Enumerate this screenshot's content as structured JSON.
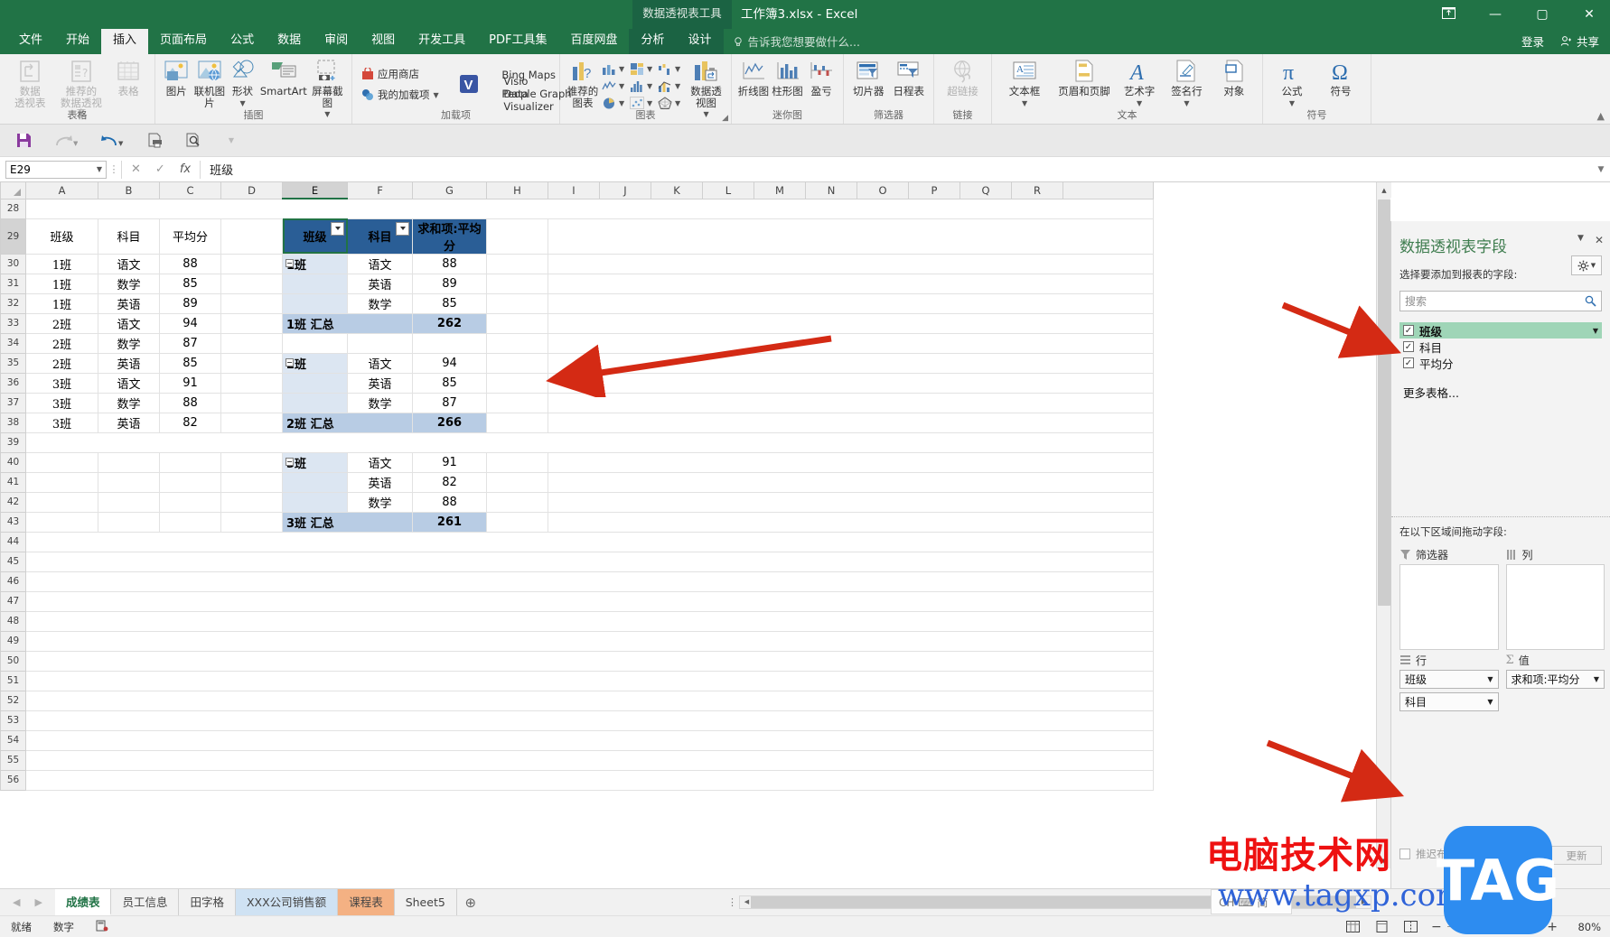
{
  "titlebar": {
    "context_tab_group": "数据透视表工具",
    "document_title": "工作簿3.xlsx - Excel",
    "signin": "登录",
    "share": "共享",
    "ribbon_display_icon": "ribbon-display-options-icon",
    "minimize": "—",
    "maximize": "▢",
    "close": "✕"
  },
  "tabs": [
    {
      "label": "文件",
      "active": false,
      "ctx": false
    },
    {
      "label": "开始",
      "active": false,
      "ctx": false
    },
    {
      "label": "插入",
      "active": true,
      "ctx": false
    },
    {
      "label": "页面布局",
      "active": false,
      "ctx": false
    },
    {
      "label": "公式",
      "active": false,
      "ctx": false
    },
    {
      "label": "数据",
      "active": false,
      "ctx": false
    },
    {
      "label": "审阅",
      "active": false,
      "ctx": false
    },
    {
      "label": "视图",
      "active": false,
      "ctx": false
    },
    {
      "label": "开发工具",
      "active": false,
      "ctx": false
    },
    {
      "label": "PDF工具集",
      "active": false,
      "ctx": false
    },
    {
      "label": "百度网盘",
      "active": false,
      "ctx": false
    },
    {
      "label": "分析",
      "active": false,
      "ctx": true
    },
    {
      "label": "设计",
      "active": false,
      "ctx": true
    }
  ],
  "tell_me": "告诉我您想要做什么...",
  "ribbon_groups": [
    {
      "name": "表格",
      "label": "表格",
      "items": [
        {
          "label": "数据\n透视表",
          "icon": "pivot-table-icon",
          "disabled": true,
          "caret": false
        },
        {
          "label": "推荐的\n数据透视表",
          "icon": "recommended-pivot-table-icon",
          "disabled": true,
          "caret": false
        },
        {
          "label": "表格",
          "icon": "table-icon",
          "disabled": true,
          "caret": false
        }
      ]
    },
    {
      "name": "插图",
      "label": "插图",
      "items": [
        {
          "label": "图片",
          "icon": "picture-icon",
          "disabled": false,
          "caret": false
        },
        {
          "label": "联机图片",
          "icon": "online-picture-icon",
          "disabled": false,
          "caret": false
        },
        {
          "label": "形状",
          "icon": "shapes-icon",
          "disabled": false,
          "caret": true
        },
        {
          "label": "SmartArt",
          "icon": "smartart-icon",
          "disabled": false,
          "caret": false
        },
        {
          "label": "屏幕截图",
          "icon": "screenshot-icon",
          "disabled": false,
          "caret": true
        }
      ]
    },
    {
      "name": "加载项",
      "label": "加载项",
      "items": [
        {
          "label": "应用商店",
          "icon": "store-icon",
          "disabled": false,
          "caret": false
        },
        {
          "label": "我的加载项",
          "icon": "my-addins-icon",
          "disabled": false,
          "caret": true
        },
        {
          "label": "Bing Maps",
          "icon": "bing-maps-icon",
          "disabled": false,
          "caret": false
        },
        {
          "label": "People Graph",
          "icon": "people-graph-icon",
          "disabled": false,
          "caret": false
        },
        {
          "label": "Visio Data Visualizer",
          "icon": "visio-data-visualizer-icon",
          "disabled": false,
          "caret": false
        }
      ]
    },
    {
      "name": "图表",
      "label": "图表",
      "items": [
        {
          "label": "推荐的\n图表",
          "icon": "recommended-charts-icon",
          "disabled": false,
          "caret": false
        },
        {
          "label": "",
          "icon": "column-chart-icon",
          "disabled": false,
          "caret": true
        },
        {
          "label": "",
          "icon": "hierarchy-chart-icon",
          "disabled": false,
          "caret": true
        },
        {
          "label": "",
          "icon": "waterfall-chart-icon",
          "disabled": false,
          "caret": true
        },
        {
          "label": "",
          "icon": "line-chart-icon",
          "disabled": false,
          "caret": true
        },
        {
          "label": "",
          "icon": "statistic-chart-icon",
          "disabled": false,
          "caret": true
        },
        {
          "label": "",
          "icon": "combo-chart-icon",
          "disabled": false,
          "caret": true
        },
        {
          "label": "",
          "icon": "pie-chart-icon",
          "disabled": false,
          "caret": true
        },
        {
          "label": "",
          "icon": "scatter-chart-icon",
          "disabled": false,
          "caret": true
        },
        {
          "label": "",
          "icon": "radar-chart-icon",
          "disabled": false,
          "caret": true
        },
        {
          "label": "数据透视图",
          "icon": "pivot-chart-icon",
          "disabled": false,
          "caret": true
        }
      ]
    },
    {
      "name": "迷你图",
      "label": "迷你图",
      "items": [
        {
          "label": "折线图",
          "icon": "sparkline-line-icon",
          "disabled": false,
          "caret": false
        },
        {
          "label": "柱形图",
          "icon": "sparkline-column-icon",
          "disabled": false,
          "caret": false
        },
        {
          "label": "盈亏",
          "icon": "sparkline-winloss-icon",
          "disabled": false,
          "caret": false
        }
      ]
    },
    {
      "name": "筛选器",
      "label": "筛选器",
      "items": [
        {
          "label": "切片器",
          "icon": "slicer-icon",
          "disabled": false,
          "caret": false
        },
        {
          "label": "日程表",
          "icon": "timeline-icon",
          "disabled": false,
          "caret": false
        }
      ]
    },
    {
      "name": "链接",
      "label": "链接",
      "items": [
        {
          "label": "超链接",
          "icon": "hyperlink-icon",
          "disabled": true,
          "caret": false
        }
      ]
    },
    {
      "name": "文本",
      "label": "文本",
      "items": [
        {
          "label": "文本框",
          "icon": "text-box-icon",
          "disabled": false,
          "caret": true
        },
        {
          "label": "页眉和页脚",
          "icon": "header-footer-icon",
          "disabled": false,
          "caret": false
        },
        {
          "label": "艺术字",
          "icon": "wordart-icon",
          "disabled": false,
          "caret": true
        },
        {
          "label": "签名行",
          "icon": "signature-line-icon",
          "disabled": false,
          "caret": true
        },
        {
          "label": "对象",
          "icon": "object-icon",
          "disabled": false,
          "caret": false
        }
      ]
    },
    {
      "name": "符号",
      "label": "符号",
      "items": [
        {
          "label": "公式",
          "icon": "equation-icon",
          "disabled": false,
          "caret": true
        },
        {
          "label": "符号",
          "icon": "symbol-icon",
          "disabled": false,
          "caret": false
        }
      ]
    }
  ],
  "qat": [
    "save-icon",
    "redo-icon",
    "undo-icon",
    "print-preview-icon",
    "quick-print-icon",
    "customize-qat-icon"
  ],
  "formula_bar": {
    "name_box_value": "E29",
    "cancel": "✕",
    "confirm": "✓",
    "fx": "fx",
    "formula_value": "班级"
  },
  "grid": {
    "columns": [
      "A",
      "B",
      "C",
      "D",
      "E",
      "F",
      "G",
      "H",
      "I",
      "J",
      "K",
      "L",
      "M",
      "N",
      "O",
      "P",
      "Q",
      "R"
    ],
    "selected_column": "E",
    "rows": [
      28,
      29,
      30,
      31,
      32,
      33,
      34,
      35,
      36,
      37,
      38,
      39,
      40,
      41,
      42,
      43,
      44,
      45,
      46,
      47,
      48,
      49,
      50,
      51,
      52,
      53,
      54,
      55,
      56
    ],
    "selected_row": 29
  },
  "source_table": {
    "headers": [
      "班级",
      "科目",
      "平均分"
    ],
    "rows": [
      [
        "1班",
        "语文",
        "88"
      ],
      [
        "1班",
        "数学",
        "85"
      ],
      [
        "1班",
        "英语",
        "89"
      ],
      [
        "2班",
        "语文",
        "94"
      ],
      [
        "2班",
        "数学",
        "87"
      ],
      [
        "2班",
        "英语",
        "85"
      ],
      [
        "3班",
        "语文",
        "91"
      ],
      [
        "3班",
        "数学",
        "88"
      ],
      [
        "3班",
        "英语",
        "82"
      ]
    ]
  },
  "pivot_table": {
    "headers": [
      "班级",
      "科目",
      "求和项:平均分"
    ],
    "groups": [
      {
        "name": "1班",
        "items": [
          {
            "subject": "语文",
            "value": "88"
          },
          {
            "subject": "英语",
            "value": "89"
          },
          {
            "subject": "数学",
            "value": "85"
          }
        ],
        "total_label": "1班 汇总",
        "total_value": "262"
      },
      {
        "name": "2班",
        "items": [
          {
            "subject": "语文",
            "value": "94"
          },
          {
            "subject": "英语",
            "value": "85"
          },
          {
            "subject": "数学",
            "value": "87"
          }
        ],
        "total_label": "2班 汇总",
        "total_value": "266"
      },
      {
        "name": "3班",
        "items": [
          {
            "subject": "语文",
            "value": "91"
          },
          {
            "subject": "英语",
            "value": "82"
          },
          {
            "subject": "数学",
            "value": "88"
          }
        ],
        "total_label": "3班 汇总",
        "total_value": "261"
      }
    ]
  },
  "panel": {
    "title": "数据透视表字段",
    "collapse_icon": "chevron-down-icon",
    "close_icon": "close-icon",
    "subtitle": "选择要添加到报表的字段:",
    "tools_icon": "gear-icon",
    "tools_caret": "chevron-down-icon",
    "search_placeholder": "搜索",
    "search_icon": "search-icon",
    "fields": [
      {
        "label": "班级",
        "checked": true,
        "selected": true
      },
      {
        "label": "科目",
        "checked": true,
        "selected": false
      },
      {
        "label": "平均分",
        "checked": true,
        "selected": false
      }
    ],
    "more_tables": "更多表格...",
    "areas_title": "在以下区域间拖动字段:",
    "areas": [
      {
        "name": "筛选器",
        "icon": "filter-icon",
        "pills": []
      },
      {
        "name": "列",
        "icon": "columns-icon",
        "pills": []
      },
      {
        "name": "行",
        "icon": "rows-icon",
        "pills": [
          "班级",
          "科目"
        ]
      },
      {
        "name": "值",
        "icon": "sigma-icon",
        "pills": [
          "求和项:平均分"
        ]
      }
    ],
    "defer_label": "推迟布局更新",
    "defer_checked": false,
    "update_button": "更新"
  },
  "sheet_tabs": [
    {
      "label": "成绩表",
      "active": true,
      "color": ""
    },
    {
      "label": "员工信息",
      "active": false,
      "color": ""
    },
    {
      "label": "田字格",
      "active": false,
      "color": ""
    },
    {
      "label": "XXX公司销售额",
      "active": false,
      "color": "blue"
    },
    {
      "label": "课程表",
      "active": false,
      "color": "orange"
    },
    {
      "label": "Sheet5",
      "active": false,
      "color": ""
    }
  ],
  "add_sheet_icon": "add-sheet-icon",
  "status_bar": {
    "ready": "就绪",
    "mode": "数字",
    "macro_icon": "record-macro-icon",
    "view_normal_icon": "normal-view-icon",
    "view_layout_icon": "page-layout-view-icon",
    "view_break_icon": "page-break-view-icon",
    "zoom_out": "−",
    "zoom_in": "+",
    "zoom_level": "80%"
  },
  "watermark": {
    "site_name": "电脑技术网",
    "site_url": "www.tagxp.com",
    "logo_text": "TAG"
  },
  "ime_hint": "CH ⌨ 简",
  "colors": {
    "excel_green": "#217346",
    "pivot_header_blue": "#2a5e96",
    "pivot_group_blue": "#dce6f2",
    "pivot_total_blue": "#b8cce4",
    "field_selected_green": "#9fd5b7",
    "arrow_red": "#d42a14"
  }
}
